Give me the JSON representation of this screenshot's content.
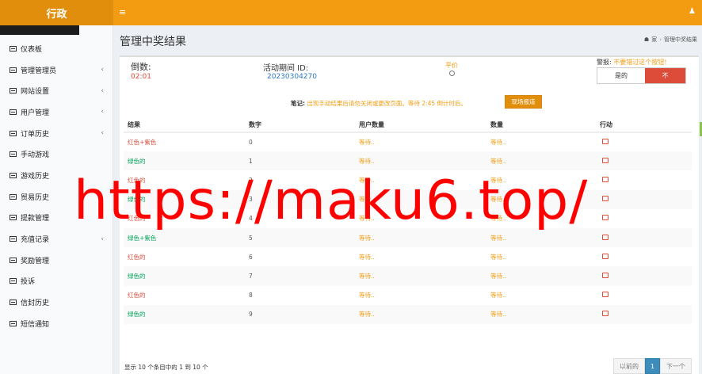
{
  "brand": "行政",
  "sidebar": {
    "items": [
      {
        "label": "仪表板",
        "caret": false
      },
      {
        "label": "管理管理员",
        "caret": true
      },
      {
        "label": "网站设置",
        "caret": true
      },
      {
        "label": "用户管理",
        "caret": true
      },
      {
        "label": "订单历史",
        "caret": true
      },
      {
        "label": "手动游戏",
        "caret": false
      },
      {
        "label": "游戏历史",
        "caret": false
      },
      {
        "label": "贸易历史",
        "caret": false
      },
      {
        "label": "提款管理",
        "caret": false
      },
      {
        "label": "充值记录",
        "caret": true
      },
      {
        "label": "奖励管理",
        "caret": false
      },
      {
        "label": "投诉",
        "caret": false
      },
      {
        "label": "信封历史",
        "caret": false
      },
      {
        "label": "短信通知",
        "caret": false
      }
    ],
    "caret_glyph": "‹"
  },
  "page": {
    "title": "管理中奖结果",
    "breadcrumb": {
      "home": "家",
      "sep": "›",
      "current": "管理中奖结果"
    }
  },
  "info": {
    "countdown_label": "倒数:",
    "countdown_value": "02:01",
    "period_label": "活动期间 ID:",
    "period_value": "20230304270",
    "draw_label": "平价",
    "warning_label": "警报:",
    "warning_text": "不要错过这个按钮!",
    "toggle_yes": "是的",
    "toggle_no": "不"
  },
  "note": {
    "label": "笔记:",
    "text": "出现手动结果后请勿关闭或更改页面。等待 2:45 倒计时后。",
    "live_button": "现场报道"
  },
  "table": {
    "headers": [
      "结果",
      "数字",
      "用户数量",
      "数量",
      "行动"
    ],
    "rows": [
      {
        "result": "红色+紫色",
        "color": "red",
        "number": "0",
        "users": "等待..",
        "amount": "等待.."
      },
      {
        "result": "绿色的",
        "color": "green",
        "number": "1",
        "users": "等待..",
        "amount": "等待.."
      },
      {
        "result": "红色的",
        "color": "red",
        "number": "2",
        "users": "等待..",
        "amount": "等待.."
      },
      {
        "result": "绿色的",
        "color": "green",
        "number": "3",
        "users": "等待..",
        "amount": "等待.."
      },
      {
        "result": "红色的",
        "color": "red",
        "number": "4",
        "users": "等待..",
        "amount": "等待.."
      },
      {
        "result": "绿色+紫色",
        "color": "green",
        "number": "5",
        "users": "等待..",
        "amount": "等待.."
      },
      {
        "result": "红色的",
        "color": "red",
        "number": "6",
        "users": "等待..",
        "amount": "等待.."
      },
      {
        "result": "绿色的",
        "color": "green",
        "number": "7",
        "users": "等待..",
        "amount": "等待.."
      },
      {
        "result": "红色的",
        "color": "red",
        "number": "8",
        "users": "等待..",
        "amount": "等待.."
      },
      {
        "result": "绿色的",
        "color": "green",
        "number": "9",
        "users": "等待..",
        "amount": "等待.."
      }
    ]
  },
  "footer": {
    "info": "显示 10 个条目中的 1 到 10 个",
    "prev": "以前的",
    "page": "1",
    "next": "下一个"
  },
  "watermark": "https://maku6.top/",
  "colors": {
    "accent": "#f39c12",
    "red": "#dd4b39",
    "green": "#00a65a",
    "pagination_active": "#3c8dbc"
  }
}
